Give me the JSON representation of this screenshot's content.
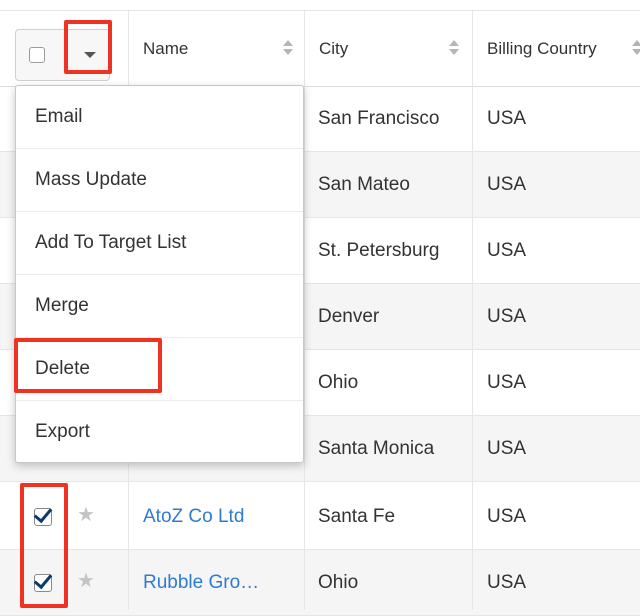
{
  "table": {
    "columns": {
      "name": "Name",
      "city": "City",
      "billing_country": "Billing Country"
    },
    "rows": [
      {
        "name": "",
        "city": "San Francisco",
        "country": "USA",
        "checked": false
      },
      {
        "name": "",
        "city": "San Mateo",
        "country": "USA",
        "checked": false
      },
      {
        "name": "",
        "city": "St. Petersburg",
        "country": "USA",
        "checked": false
      },
      {
        "name": "",
        "city": "Denver",
        "country": "USA",
        "checked": false
      },
      {
        "name": "",
        "city": "Ohio",
        "country": "USA",
        "checked": false
      },
      {
        "name": "",
        "city": "Santa Monica",
        "country": "USA",
        "checked": false
      },
      {
        "name": "AtoZ Co Ltd",
        "city": "Santa Fe",
        "country": "USA",
        "checked": true
      },
      {
        "name": "Rubble Gro…",
        "city": "Ohio",
        "country": "USA",
        "checked": true
      }
    ]
  },
  "actions_menu": {
    "items": [
      "Email",
      "Mass Update",
      "Add To Target List",
      "Merge",
      "Delete",
      "Export"
    ]
  },
  "icons": {
    "sort": "sort-icon",
    "favorite": "star-icon",
    "dropdown": "caret-down-icon"
  },
  "colors": {
    "link": "#2f7bd0",
    "highlight": "#ee3322",
    "checkbox_check": "#0a3d6b"
  }
}
